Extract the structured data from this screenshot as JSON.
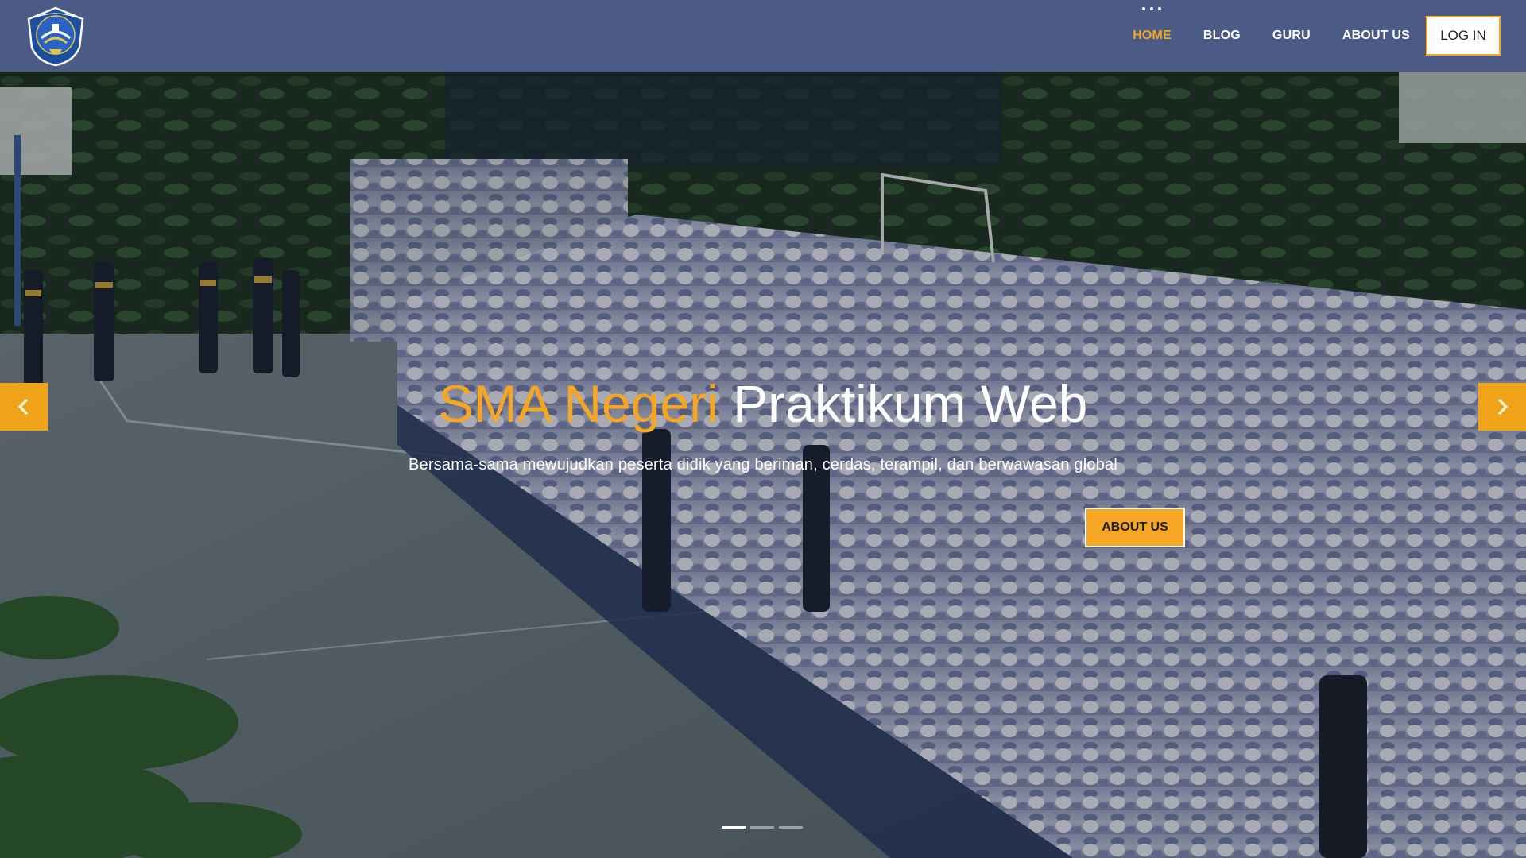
{
  "brand": {
    "logo_icon": "tut-wuri-handayani-logo",
    "logo_text": "TUT WURI HANDAYANI"
  },
  "nav": {
    "items": [
      {
        "label": "HOME",
        "active": true
      },
      {
        "label": "BLOG",
        "active": false
      },
      {
        "label": "GURU",
        "active": false
      },
      {
        "label": "ABOUT US",
        "active": false
      }
    ],
    "login_label": "LOG IN"
  },
  "hero": {
    "title_accent": "SMA Negeri",
    "title_rest": "Praktikum Web",
    "subtitle": "Bersama-sama mewujudkan peserta didik yang beriman, cerdas, terampil, dan berwawasan global",
    "cta_label": "ABOUT US",
    "prev_icon": "chevron-left-icon",
    "next_icon": "chevron-right-icon",
    "slide_count": 3,
    "active_slide": 1
  },
  "colors": {
    "navbar": "#4b5b85",
    "accent": "#f5a623",
    "text_light": "#ffffff"
  }
}
